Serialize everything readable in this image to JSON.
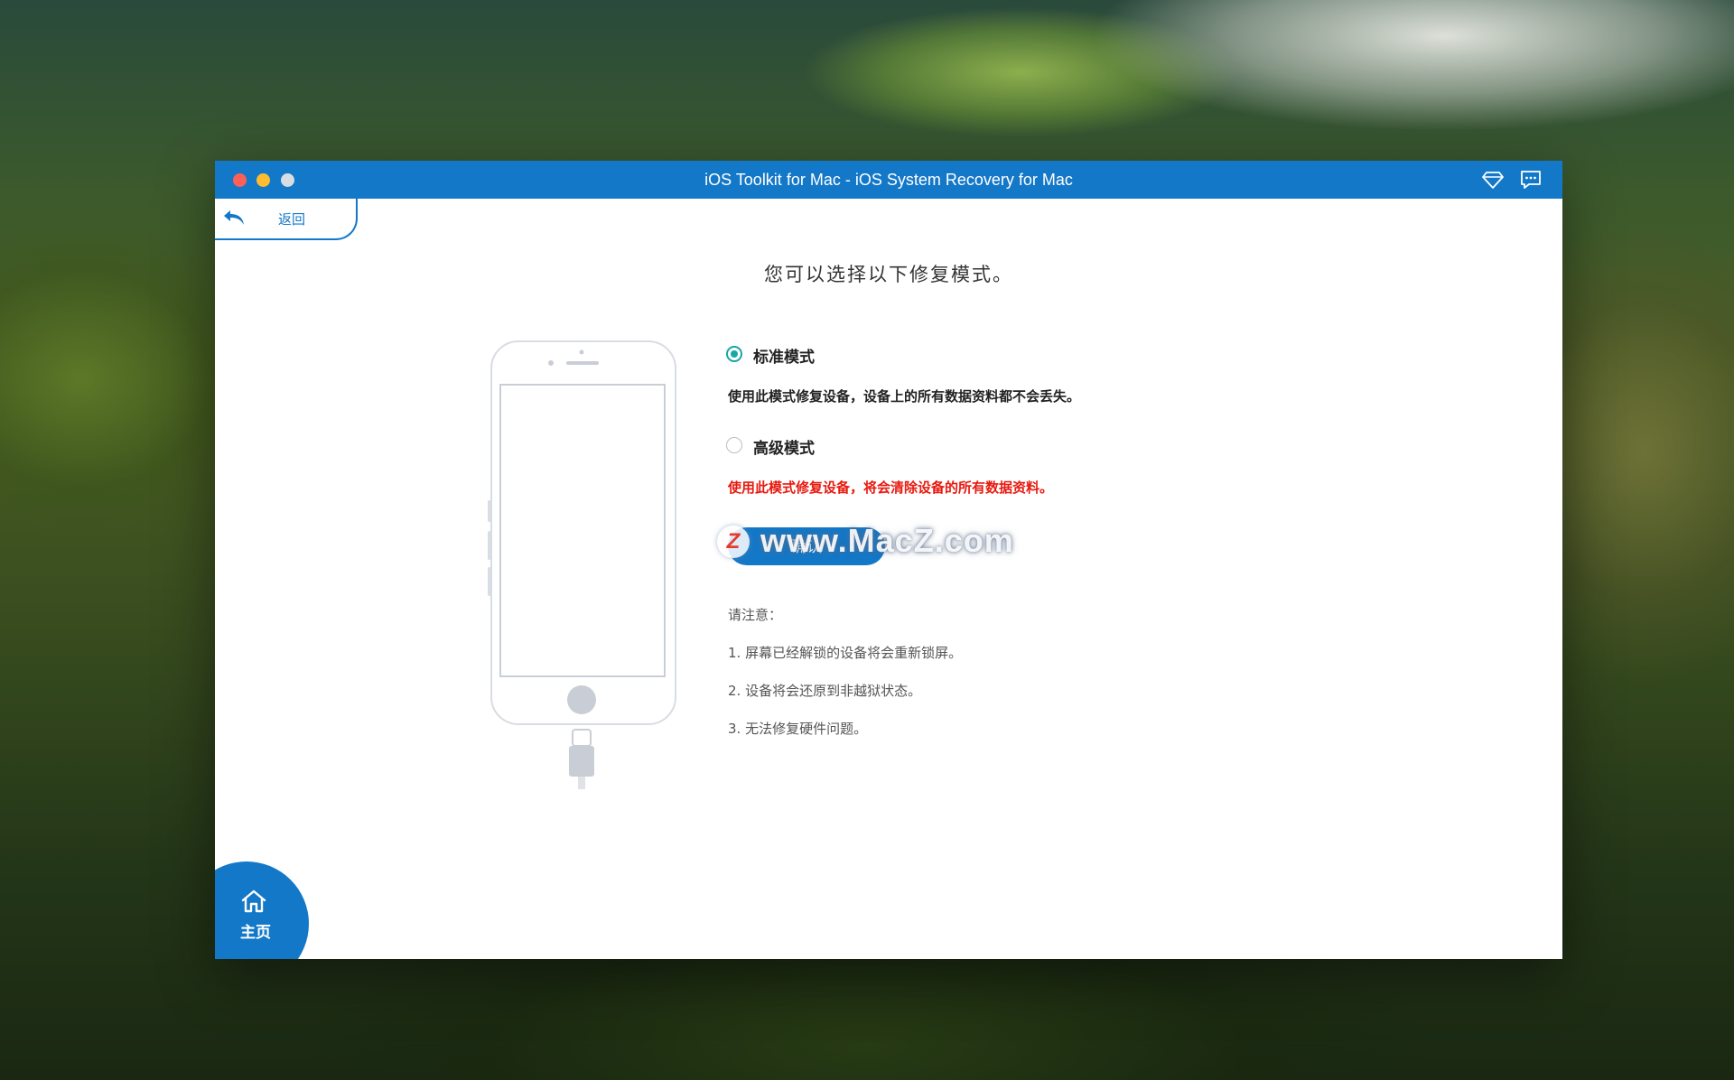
{
  "window": {
    "title": "iOS Toolkit for Mac - iOS System Recovery for Mac"
  },
  "nav": {
    "back_label": "返回",
    "home_label": "主页"
  },
  "main": {
    "heading": "您可以选择以下修复模式。",
    "modes": [
      {
        "label": "标准模式",
        "description": "使用此模式修复设备，设备上的所有数据资料都不会丢失。",
        "selected": true
      },
      {
        "label": "高级模式",
        "description": "使用此模式修复设备，将会清除设备的所有数据资料。",
        "selected": false
      }
    ],
    "confirm_label": "确认",
    "notes_title": "请注意：",
    "notes": [
      "1. 屏幕已经解锁的设备将会重新锁屏。",
      "2. 设备将会还原到非越狱状态。",
      "3. 无法修复硬件问题。"
    ]
  },
  "watermark": {
    "logo_letter": "Z",
    "text": "www.MacZ.com"
  },
  "colors": {
    "accent": "#1478c8",
    "radio_selected": "#18a6a6",
    "warning": "#e8190f"
  },
  "icons": {
    "back": "back-arrow-icon",
    "premium": "diamond-icon",
    "feedback": "chat-icon",
    "home": "home-icon",
    "device": "iphone-illustration"
  }
}
